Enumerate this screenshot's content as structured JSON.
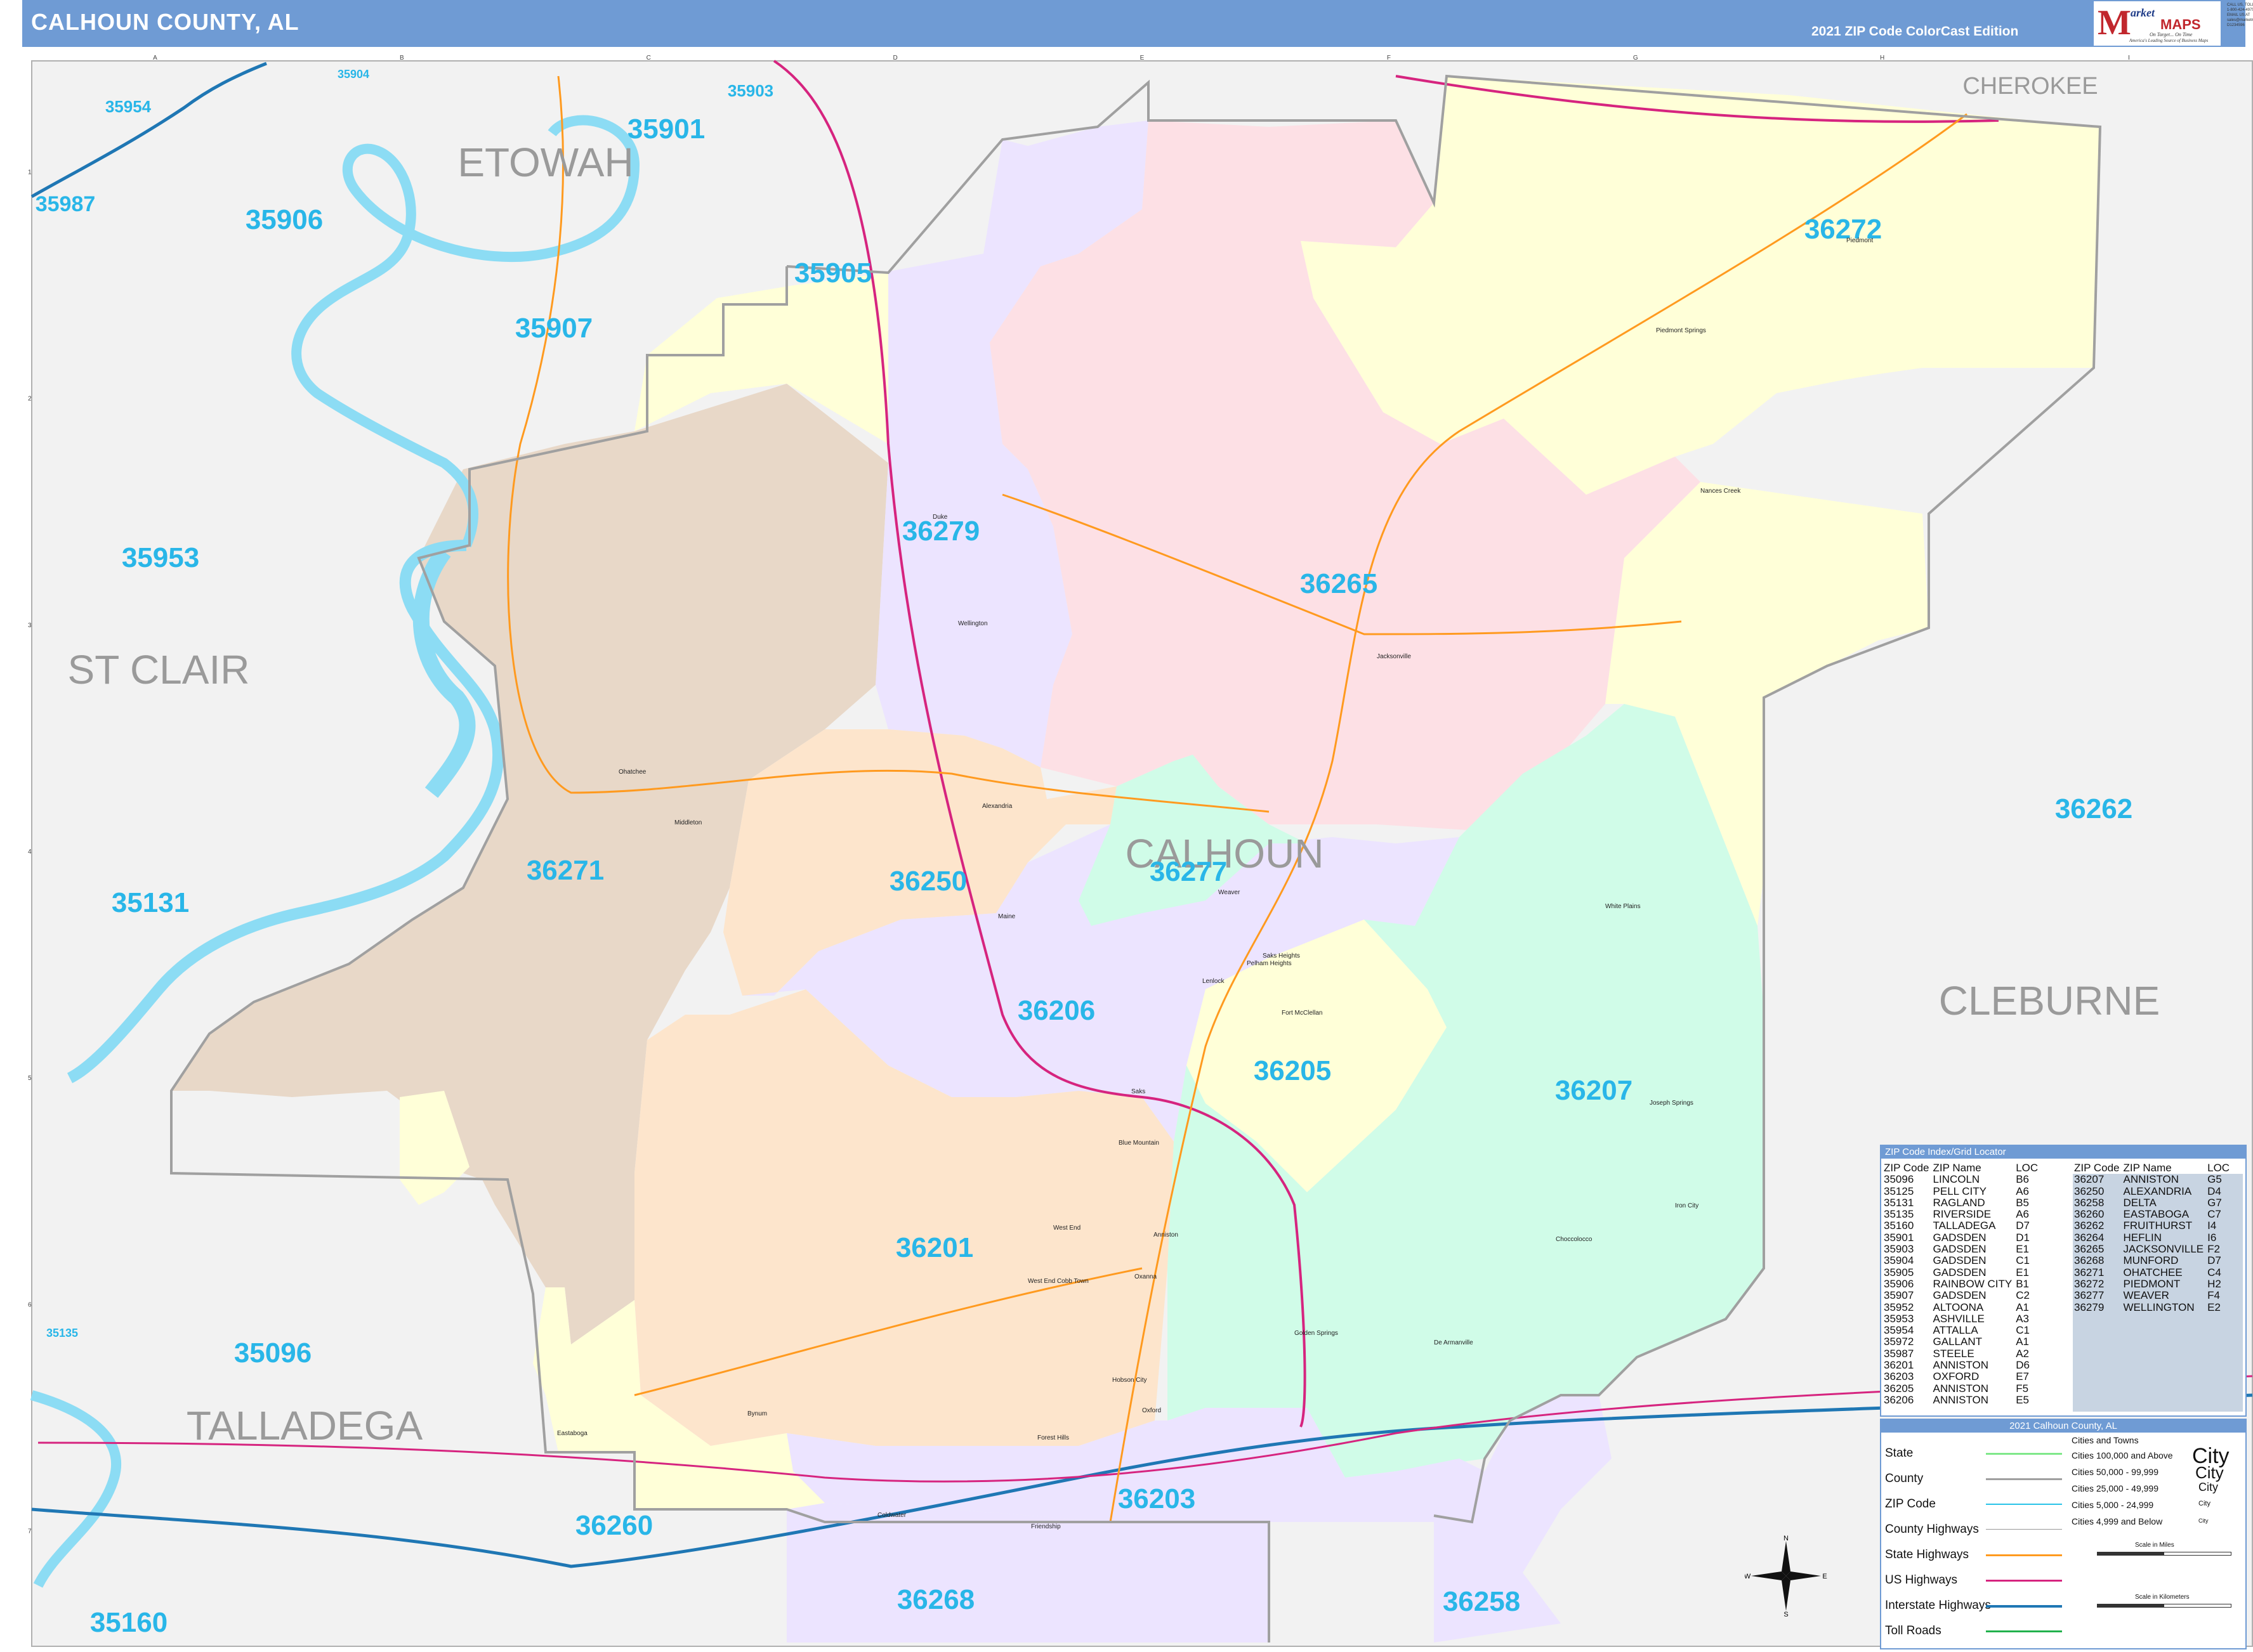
{
  "header": {
    "title": "CALHOUN COUNTY, AL",
    "edition": "2021 ZIP Code ColorCast Edition"
  },
  "brand": {
    "logo_letter": "M",
    "name_part1": "arket",
    "name_part2": "MAPS",
    "tagline1": "On Target... On Time",
    "tagline2": "America's Leading Source of Business Maps",
    "contact": [
      "CALL US, TOLL FREE",
      "1-800-424-4975",
      "EMAIL US AT",
      "sales@marketmaps.com",
      "D1234596"
    ]
  },
  "colors": {
    "header_bg": "#6f9bd4",
    "zip_label": "#29b6e8",
    "county_label": "#9a9a9a",
    "zip_boundary": "#29c3e8",
    "county_boundary": "#a0a0a0",
    "water": "#8cdcf4",
    "background": "#f2f2f2",
    "interstate": "#1f77b4",
    "us_highway": "#d6247f",
    "state_highway": "#ff9a1f",
    "zone_pink": "#fde0e5",
    "zone_yellow": "#ffffd8",
    "zone_lavender": "#ece4ff",
    "zone_peach": "#fde5cc",
    "zone_tan": "#e8d8c8",
    "zone_mint": "#d0fce8"
  },
  "grid": {
    "columns": [
      "A",
      "B",
      "C",
      "D",
      "E",
      "F",
      "G",
      "H",
      "I"
    ],
    "rows": [
      "1",
      "2",
      "3",
      "4",
      "5",
      "6",
      "7"
    ]
  },
  "counties": [
    "ETOWAH",
    "CHEROKEE",
    "ST CLAIR",
    "CALHOUN",
    "CLEBURNE",
    "TALLADEGA"
  ],
  "zip_labels": [
    "35954",
    "35904",
    "35903",
    "35901",
    "35987",
    "35906",
    "35905",
    "35907",
    "36272",
    "36279",
    "35953",
    "36265",
    "36262",
    "36250",
    "36277",
    "36271",
    "35131",
    "36206",
    "36205",
    "36207",
    "36201",
    "35096",
    "36260",
    "36203",
    "35160",
    "36268",
    "36258",
    "35135"
  ],
  "places": [
    "Piedmont",
    "Piedmont Springs",
    "Nances Creek",
    "Duke",
    "Wellington",
    "Jacksonville",
    "Ohatchee",
    "Middleton",
    "Alexandria",
    "Weaver",
    "Maine",
    "Pelham Heights",
    "Saks Heights",
    "Lenlock",
    "Fort McClellan",
    "White Plains",
    "Saks",
    "Blue Mountain",
    "Joseph Springs",
    "Iron City",
    "West End",
    "Anniston",
    "West End Cobb Town",
    "Oxanna",
    "Choccolocco",
    "Golden Springs",
    "De Armanville",
    "Hobson City",
    "Oxford",
    "Bynum",
    "Forest Hills",
    "Eastaboga",
    "Coldwater",
    "Friendship"
  ],
  "zip_index": {
    "title": "ZIP Code Index/Grid Locator",
    "headers": [
      "ZIP Code",
      "ZIP Name",
      "LOC"
    ],
    "left": [
      [
        "35096",
        "LINCOLN",
        "B6"
      ],
      [
        "35125",
        "PELL CITY",
        "A6"
      ],
      [
        "35131",
        "RAGLAND",
        "B5"
      ],
      [
        "35135",
        "RIVERSIDE",
        "A6"
      ],
      [
        "35160",
        "TALLADEGA",
        "D7"
      ],
      [
        "35901",
        "GADSDEN",
        "D1"
      ],
      [
        "35903",
        "GADSDEN",
        "E1"
      ],
      [
        "35904",
        "GADSDEN",
        "C1"
      ],
      [
        "35905",
        "GADSDEN",
        "E1"
      ],
      [
        "35906",
        "RAINBOW CITY",
        "B1"
      ],
      [
        "35907",
        "GADSDEN",
        "C2"
      ],
      [
        "35952",
        "ALTOONA",
        "A1"
      ],
      [
        "35953",
        "ASHVILLE",
        "A3"
      ],
      [
        "35954",
        "ATTALLA",
        "C1"
      ],
      [
        "35972",
        "GALLANT",
        "A1"
      ],
      [
        "35987",
        "STEELE",
        "A2"
      ],
      [
        "36201",
        "ANNISTON",
        "D6"
      ],
      [
        "36203",
        "OXFORD",
        "E7"
      ],
      [
        "36205",
        "ANNISTON",
        "F5"
      ],
      [
        "36206",
        "ANNISTON",
        "E5"
      ]
    ],
    "right": [
      [
        "36207",
        "ANNISTON",
        "G5"
      ],
      [
        "36250",
        "ALEXANDRIA",
        "D4"
      ],
      [
        "36258",
        "DELTA",
        "G7"
      ],
      [
        "36260",
        "EASTABOGA",
        "C7"
      ],
      [
        "36262",
        "FRUITHURST",
        "I4"
      ],
      [
        "36264",
        "HEFLIN",
        "I6"
      ],
      [
        "36265",
        "JACKSONVILLE",
        "F2"
      ],
      [
        "36268",
        "MUNFORD",
        "D7"
      ],
      [
        "36271",
        "OHATCHEE",
        "C4"
      ],
      [
        "36272",
        "PIEDMONT",
        "H2"
      ],
      [
        "36277",
        "WEAVER",
        "F4"
      ],
      [
        "36279",
        "WELLINGTON",
        "E2"
      ]
    ]
  },
  "legend": {
    "title": "2021 Calhoun County, AL",
    "rows": [
      "State",
      "County",
      "ZIP Code",
      "County Highways",
      "State Highways",
      "US Highways",
      "Interstate Highways",
      "Toll Roads"
    ],
    "cities_title": "Cities and Towns",
    "city_sizes": [
      "Cities 100,000 and Above",
      "Cities 50,000 - 99,999",
      "Cities 25,000 - 49,999",
      "Cities 5,000 - 24,999",
      "Cities 4,999 and Below"
    ],
    "city_samples": [
      "City",
      "City",
      "City",
      "City",
      "City"
    ],
    "scale_miles": "Scale in Miles",
    "scale_km": "Scale in Kilometers"
  },
  "compass": {
    "n": "N",
    "s": "S",
    "e": "E",
    "w": "W"
  }
}
